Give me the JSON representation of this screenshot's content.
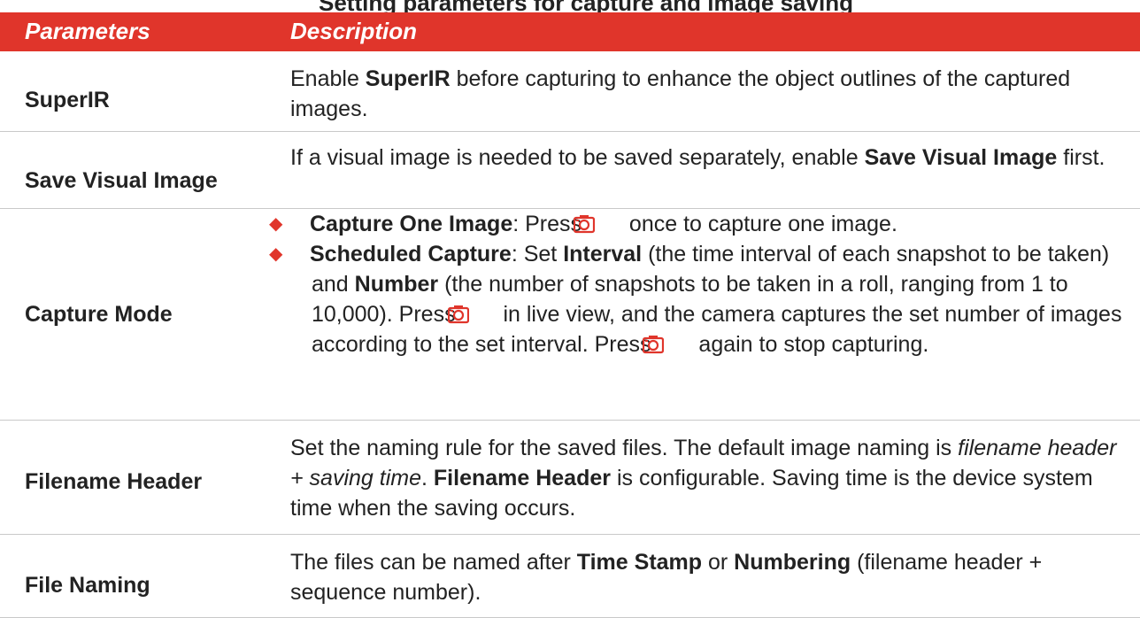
{
  "caption_fragment": "Setting parameters for capture and image saving",
  "header": {
    "col1": "Parameters",
    "col2": "Description"
  },
  "rows": [
    {
      "param": "SuperIR",
      "desc": {
        "p1": "Enable ",
        "b1": "SuperIR",
        "p2": " before capturing to enhance the object outlines of the captured images."
      }
    },
    {
      "param": "Save Visual Image",
      "desc": {
        "p1": "If a visual image is needed to be saved separately, enable ",
        "b1": "Save Visual Image",
        "p2": " first."
      }
    },
    {
      "param": "Capture Mode",
      "bullets": [
        {
          "b1": "Capture One Image",
          "p1": ": Press ",
          "p2": " once to capture one image."
        },
        {
          "b1": "Scheduled Capture",
          "p1": ": Set ",
          "b2": "Interval",
          "p2": " (the time interval of each snapshot to be taken) and ",
          "b3": "Number",
          "p3": " (the number of snapshots to be taken in a roll, ranging from 1 to 10,000). Press ",
          "p4": " in live view, and the camera captures the set number of images according to the set interval. Press ",
          "p5": " again to stop capturing."
        }
      ]
    },
    {
      "param": "Filename Header",
      "desc": {
        "p1": "Set the naming rule for the saved files. The default image naming is ",
        "i1": "filename header + saving time",
        "p2": ". ",
        "b1": "Filename Header",
        "p3": " is configurable. Saving time is the device system time when the saving occurs."
      }
    },
    {
      "param": "File Naming",
      "desc": {
        "p1": "The files can be named after ",
        "b1": "Time Stamp",
        "p2": " or ",
        "b2": "Numbering",
        "p3": " (filename header + sequence number)."
      }
    }
  ],
  "icons": {
    "capture": "camera-icon",
    "bullet": "diamond-bullet-icon"
  },
  "colors": {
    "header_bg": "#e0352b",
    "bullet": "#e0352b",
    "icon": "#e0352b"
  }
}
